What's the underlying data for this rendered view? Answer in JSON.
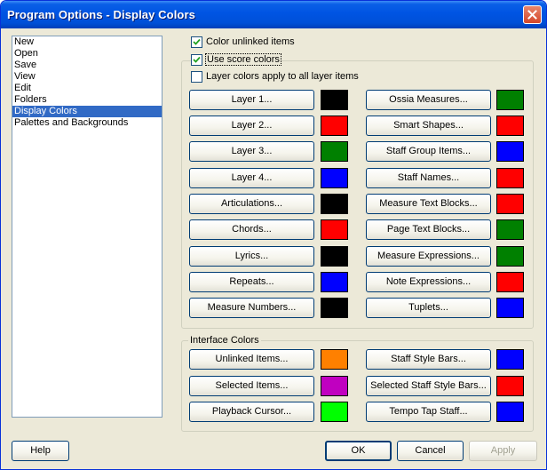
{
  "window": {
    "title": "Program Options - Display Colors"
  },
  "sidebar": {
    "items": [
      "New",
      "Open",
      "Save",
      "View",
      "Edit",
      "Folders",
      "Display Colors",
      "Palettes and Backgrounds"
    ],
    "selected_index": 6
  },
  "options": {
    "color_unlinked": {
      "label": "Color unlinked items",
      "checked": true
    },
    "use_score_colors": {
      "label": "Use score colors",
      "checked": true
    },
    "layer_colors_all": {
      "label": "Layer colors apply to all layer items",
      "checked": false
    }
  },
  "score_colors": {
    "left": [
      {
        "label": "Layer 1...",
        "color": "#000000"
      },
      {
        "label": "Layer 2...",
        "color": "#ff0000"
      },
      {
        "label": "Layer 3...",
        "color": "#008000"
      },
      {
        "label": "Layer 4...",
        "color": "#0000ff"
      },
      {
        "label": "Articulations...",
        "color": "#000000"
      },
      {
        "label": "Chords...",
        "color": "#ff0000"
      },
      {
        "label": "Lyrics...",
        "color": "#000000"
      },
      {
        "label": "Repeats...",
        "color": "#0000ff"
      },
      {
        "label": "Measure Numbers...",
        "color": "#000000"
      }
    ],
    "right": [
      {
        "label": "Ossia Measures...",
        "color": "#008000"
      },
      {
        "label": "Smart Shapes...",
        "color": "#ff0000"
      },
      {
        "label": "Staff Group Items...",
        "color": "#0000ff"
      },
      {
        "label": "Staff Names...",
        "color": "#ff0000"
      },
      {
        "label": "Measure Text Blocks...",
        "color": "#ff0000"
      },
      {
        "label": "Page Text Blocks...",
        "color": "#008000"
      },
      {
        "label": "Measure Expressions...",
        "color": "#008000"
      },
      {
        "label": "Note Expressions...",
        "color": "#ff0000"
      },
      {
        "label": "Tuplets...",
        "color": "#0000ff"
      }
    ]
  },
  "interface_colors": {
    "title": "Interface Colors",
    "left": [
      {
        "label": "Unlinked Items...",
        "color": "#ff8000"
      },
      {
        "label": "Selected Items...",
        "color": "#c000c0"
      },
      {
        "label": "Playback Cursor...",
        "color": "#00ff00"
      }
    ],
    "right": [
      {
        "label": "Staff Style Bars...",
        "color": "#0000ff"
      },
      {
        "label": "Selected Staff Style Bars...",
        "color": "#ff0000"
      },
      {
        "label": "Tempo Tap Staff...",
        "color": "#0000ff"
      }
    ]
  },
  "footer": {
    "help": "Help",
    "ok": "OK",
    "cancel": "Cancel",
    "apply": "Apply"
  }
}
